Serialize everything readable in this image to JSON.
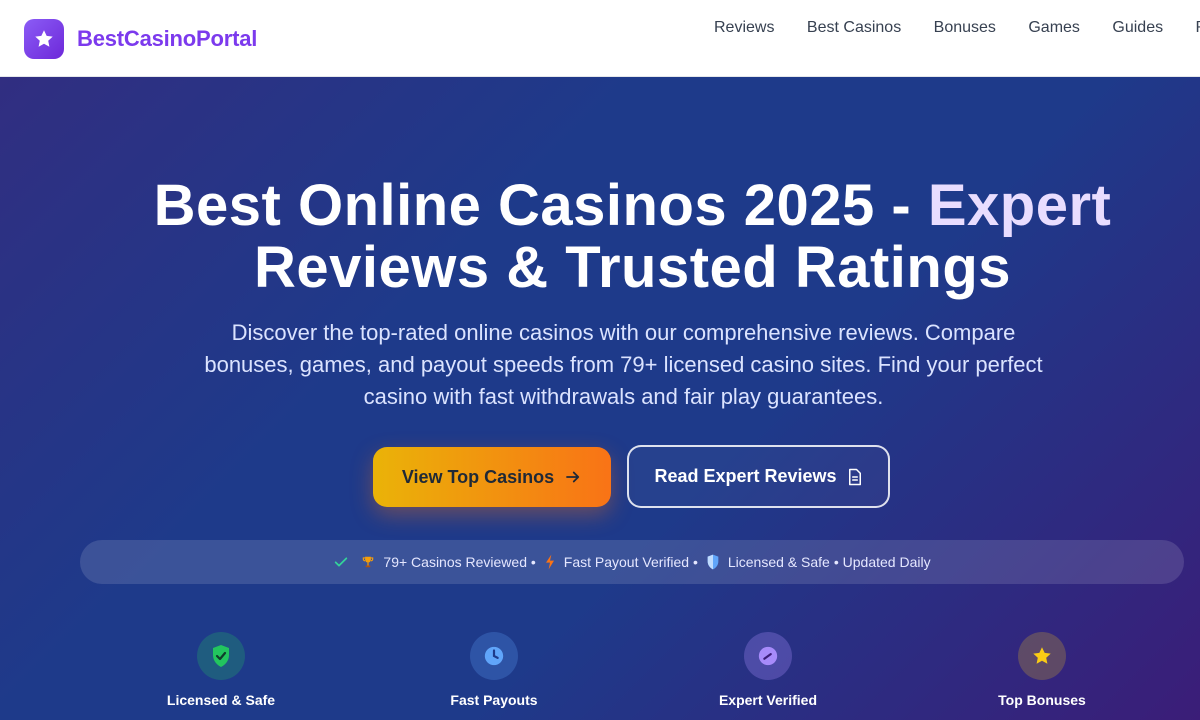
{
  "brand": {
    "name": "BestCasinoPortal",
    "icon": "star-icon"
  },
  "nav": {
    "items": [
      "Reviews",
      "Best Casinos",
      "Bonuses",
      "Games",
      "Guides",
      "Re"
    ]
  },
  "hero": {
    "title_main": "Best Online Casinos 2025 - ",
    "title_accent": "Expert",
    "title_line2": "Reviews & Trusted Ratings",
    "subtitle": "Discover the top-rated online casinos with our comprehensive reviews. Compare bonuses, games, and payout speeds from 79+ licensed casino sites. Find your perfect casino with fast withdrawals and fair play guarantees.",
    "primary_button": {
      "label": "View Top Casinos",
      "icon": "arrow-right-icon"
    },
    "secondary_button": {
      "label": "Read Expert Reviews",
      "icon": "document-icon"
    }
  },
  "trust_bar": {
    "items": [
      "79+ Casinos Reviewed •",
      "Fast Payout Verified •",
      "Licensed & Safe",
      "• Updated Daily"
    ],
    "icons": [
      "check-icon",
      "trophy-icon",
      "lightning-icon",
      "shield-icon"
    ]
  },
  "features": [
    {
      "label": "Licensed & Safe",
      "icon": "shield-check-icon",
      "color": "#22c55e"
    },
    {
      "label": "Fast Payouts",
      "icon": "clock-icon",
      "color": "#60a5fa"
    },
    {
      "label": "Expert Verified",
      "icon": "gauge-icon",
      "color": "#a78bfa"
    },
    {
      "label": "Top Bonuses",
      "icon": "star-icon",
      "color": "#facc15"
    }
  ],
  "colors": {
    "brand": "#7c3aed",
    "cta_start": "#eab308",
    "cta_end": "#f97316",
    "hero_bg": "#1e3a8a"
  }
}
